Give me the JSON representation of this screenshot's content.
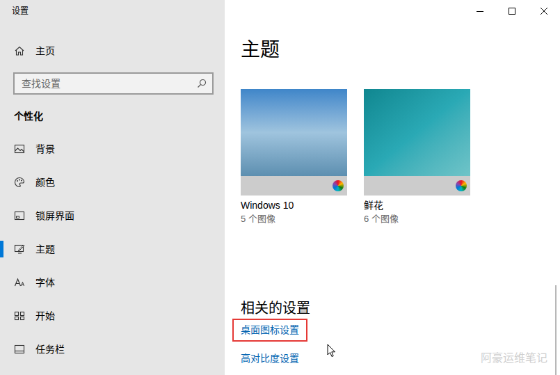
{
  "window": {
    "title": "设置"
  },
  "sidebar": {
    "home": "主页",
    "search": {
      "placeholder": "查找设置"
    },
    "section": "个性化",
    "items": [
      {
        "label": "背景",
        "selected": false
      },
      {
        "label": "颜色",
        "selected": false
      },
      {
        "label": "锁屏界面",
        "selected": false
      },
      {
        "label": "主题",
        "selected": true
      },
      {
        "label": "字体",
        "selected": false
      },
      {
        "label": "开始",
        "selected": false
      },
      {
        "label": "任务栏",
        "selected": false
      }
    ]
  },
  "content": {
    "heading": "主题",
    "themes": [
      {
        "name": "Windows 10",
        "count": "5 个图像"
      },
      {
        "name": "鲜花",
        "count": "6 个图像"
      }
    ],
    "related": {
      "heading": "相关的设置",
      "links": [
        {
          "label": "桌面图标设置",
          "highlighted": true
        },
        {
          "label": "高对比度设置",
          "highlighted": false
        }
      ]
    }
  },
  "watermark": "阿豪运维笔记"
}
